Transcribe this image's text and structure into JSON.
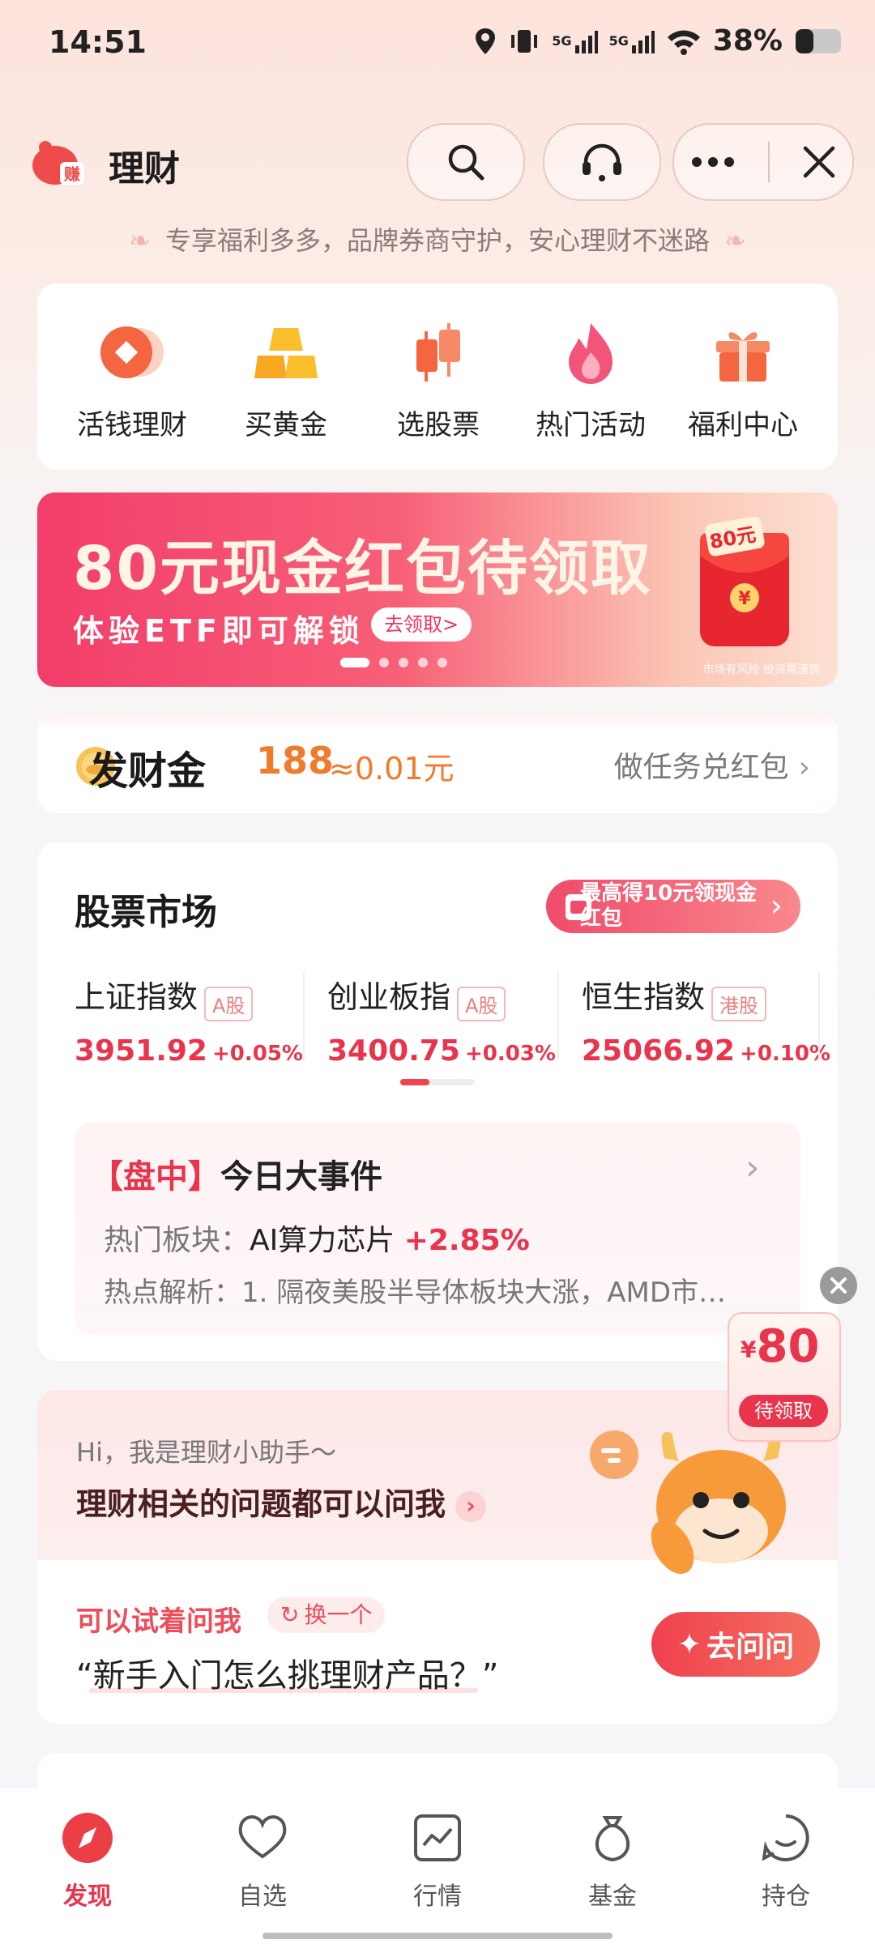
{
  "status": {
    "time": "14:51",
    "battery": "38%",
    "signal_labels": [
      "5G",
      "5G"
    ]
  },
  "header": {
    "title": "理财",
    "logo_text": "赚",
    "tagline": "专享福利多多，品牌券商守护，安心理财不迷路"
  },
  "quick_nav": [
    {
      "label": "活钱理财",
      "icon": "coin-stack-icon"
    },
    {
      "label": "买黄金",
      "icon": "gold-bars-icon"
    },
    {
      "label": "选股票",
      "icon": "candlestick-icon"
    },
    {
      "label": "热门活动",
      "icon": "flame-icon"
    },
    {
      "label": "福利中心",
      "icon": "gift-box-icon"
    }
  ],
  "banner": {
    "title": "80元现金红包待领取",
    "subtitle": "体验ETF即可解锁",
    "button": "去领取>",
    "envelope_amount": "80元",
    "note": "市场有风险 投资需谨慎",
    "slides": 5,
    "active_slide": 1
  },
  "coins": {
    "label": "发财金",
    "amount": "188",
    "approx": "≈0.01元",
    "task": "做任务兑红包"
  },
  "market": {
    "title": "股票市场",
    "promo_pill": "最高得10元领现金红包",
    "indices": [
      {
        "name": "上证指数",
        "tag": "A股",
        "value": "3951.92",
        "change": "+0.05%"
      },
      {
        "name": "创业板指",
        "tag": "A股",
        "value": "3400.75",
        "change": "+0.03%"
      },
      {
        "name": "恒生指数",
        "tag": "港股",
        "value": "25066.92",
        "change": "+0.10%"
      }
    ],
    "event": {
      "prefix": "【盘中】",
      "title": "今日大事件",
      "hot_label": "热门板块：",
      "hot_sector": "AI算力芯片",
      "hot_change": "+2.85%",
      "analysis": "热点解析：1. 隔夜美股半导体板块大涨，AMD市…"
    }
  },
  "float_promo": {
    "currency": "¥",
    "amount": "80",
    "button": "待领取"
  },
  "assistant": {
    "greeting": "Hi，我是理财小助手～",
    "prompt": "理财相关的问题都可以问我",
    "try_label": "可以试着问我",
    "change": "换一个",
    "question": "“新手入门怎么挑理财产品？”",
    "ask_button": "去问问"
  },
  "tabs": [
    {
      "label": "发现",
      "icon": "compass-icon",
      "active": true
    },
    {
      "label": "自选",
      "icon": "heart-icon",
      "active": false
    },
    {
      "label": "行情",
      "icon": "chart-line-icon",
      "active": false
    },
    {
      "label": "基金",
      "icon": "money-bag-icon",
      "active": false
    },
    {
      "label": "持仓",
      "icon": "smile-face-icon",
      "active": false
    }
  ],
  "colors": {
    "accent": "#e8344c",
    "orange": "#f07b2c",
    "banner_start": "#f23d6a",
    "background_top": "#fde3dc"
  }
}
